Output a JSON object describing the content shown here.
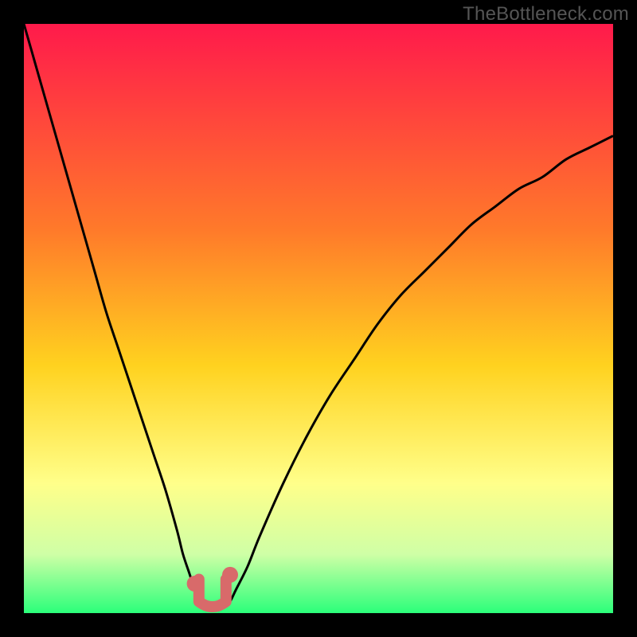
{
  "watermark": "TheBottleneck.com",
  "colors": {
    "frame": "#000000",
    "gradient_top": "#ff1a4b",
    "gradient_mid1": "#ff7a2a",
    "gradient_mid2": "#ffd21f",
    "gradient_mid3": "#ffff8a",
    "gradient_mid4": "#cfffa6",
    "gradient_bottom": "#2bff7a",
    "curve": "#000000",
    "detail": "#d86a6a"
  },
  "chart_data": {
    "type": "line",
    "title": "",
    "xlabel": "",
    "ylabel": "",
    "xlim": [
      0,
      100
    ],
    "ylim": [
      0,
      100
    ],
    "series": [
      {
        "name": "bottleneck-curve",
        "x": [
          0,
          2,
          4,
          6,
          8,
          10,
          12,
          14,
          16,
          18,
          20,
          22,
          24,
          26,
          27,
          28,
          29,
          30,
          31,
          32,
          33,
          34,
          35,
          36,
          38,
          40,
          44,
          48,
          52,
          56,
          60,
          64,
          68,
          72,
          76,
          80,
          84,
          88,
          92,
          96,
          100
        ],
        "y": [
          100,
          93,
          86,
          79,
          72,
          65,
          58,
          51,
          45,
          39,
          33,
          27,
          21,
          14,
          10,
          7,
          4,
          2,
          1,
          0.5,
          0.5,
          1,
          2,
          4,
          8,
          13,
          22,
          30,
          37,
          43,
          49,
          54,
          58,
          62,
          66,
          69,
          72,
          74,
          77,
          79,
          81
        ]
      }
    ],
    "annotations": [
      {
        "name": "min-dot-left",
        "x": 29.0,
        "y": 5.0,
        "shape": "dot"
      },
      {
        "name": "min-dot-right",
        "x": 35.0,
        "y": 6.5,
        "shape": "dot"
      },
      {
        "name": "min-u",
        "x": 32.0,
        "y": 2.5,
        "shape": "u"
      }
    ],
    "background_gradient": {
      "direction": "vertical",
      "stops": [
        {
          "offset": 0.0,
          "color": "#ff1a4b"
        },
        {
          "offset": 0.35,
          "color": "#ff7a2a"
        },
        {
          "offset": 0.58,
          "color": "#ffd21f"
        },
        {
          "offset": 0.78,
          "color": "#ffff8a"
        },
        {
          "offset": 0.9,
          "color": "#cfffa6"
        },
        {
          "offset": 1.0,
          "color": "#2bff7a"
        }
      ]
    }
  }
}
